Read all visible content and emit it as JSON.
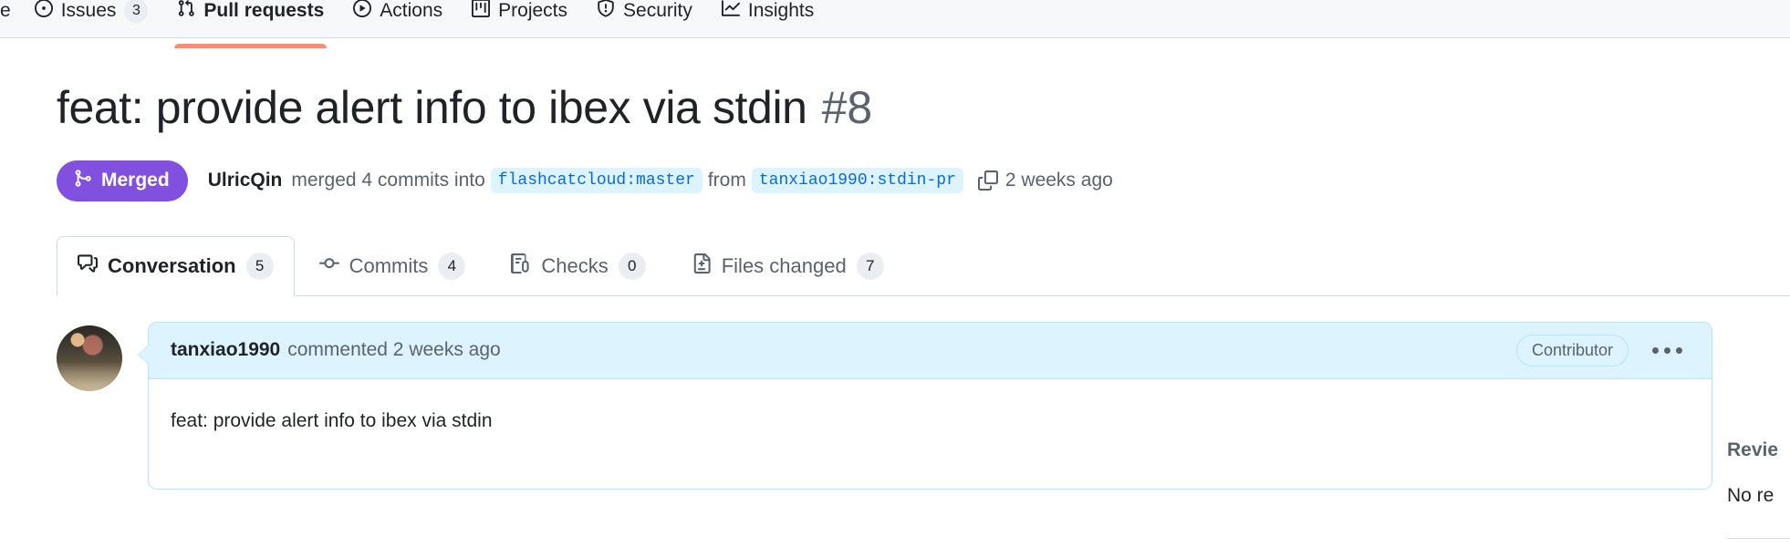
{
  "repo_nav": {
    "items": [
      {
        "label": "e",
        "icon": "code-icon",
        "counter": null,
        "active": false,
        "truncated": true
      },
      {
        "label": "Issues",
        "icon": "issue-opened-icon",
        "counter": "3",
        "active": false
      },
      {
        "label": "Pull requests",
        "icon": "git-pull-request-icon",
        "counter": null,
        "active": true
      },
      {
        "label": "Actions",
        "icon": "play-icon",
        "counter": null,
        "active": false
      },
      {
        "label": "Projects",
        "icon": "project-icon",
        "counter": null,
        "active": false
      },
      {
        "label": "Security",
        "icon": "shield-icon",
        "counter": null,
        "active": false
      },
      {
        "label": "Insights",
        "icon": "graph-icon",
        "counter": null,
        "active": false
      }
    ],
    "active_underline_color": "#fd8c73"
  },
  "pull_request": {
    "title": "feat: provide alert info to ibex via stdin",
    "number": "#8",
    "state": {
      "label": "Merged",
      "icon": "git-merge-icon",
      "color": "#8250df"
    },
    "meta": {
      "author": "UlricQin",
      "action_text": "merged 4 commits into",
      "base_branch": "flashcatcloud:master",
      "from_text": "from",
      "head_branch": "tanxiao1990:stdin-pr",
      "copy_icon": "copy-icon",
      "timestamp": "2 weeks ago"
    }
  },
  "pr_tabs": [
    {
      "label": "Conversation",
      "icon": "comment-discussion-icon",
      "counter": "5",
      "active": true
    },
    {
      "label": "Commits",
      "icon": "git-commit-icon",
      "counter": "4",
      "active": false
    },
    {
      "label": "Checks",
      "icon": "checklist-icon",
      "counter": "0",
      "active": false
    },
    {
      "label": "Files changed",
      "icon": "file-diff-icon",
      "counter": "7",
      "active": false
    }
  ],
  "comment": {
    "avatar": "user-avatar",
    "author": "tanxiao1990",
    "action": "commented 2 weeks ago",
    "badge": "Contributor",
    "menu_icon": "kebab-horizontal-icon",
    "body": "feat: provide alert info to ibex via stdin"
  },
  "sidebar": {
    "reviewers_heading": "Revie",
    "reviewers_empty": "No re"
  }
}
